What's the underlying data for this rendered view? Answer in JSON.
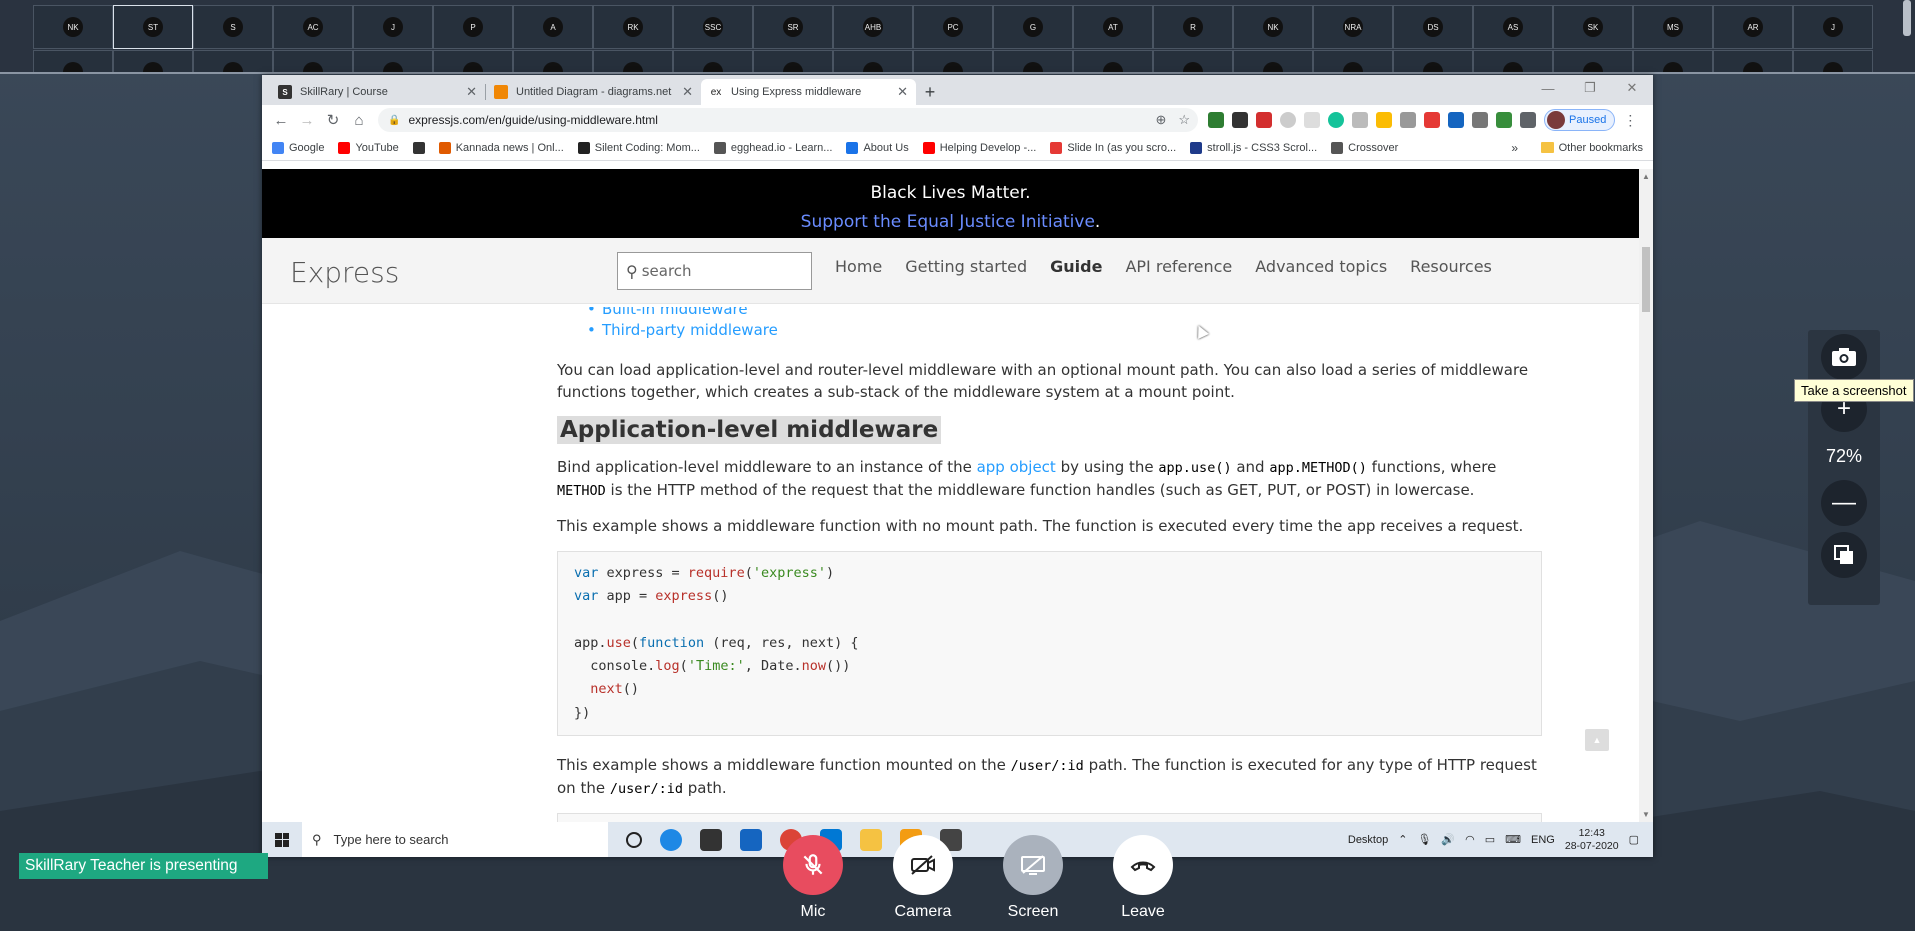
{
  "participants": {
    "row1": [
      "NK",
      "ST",
      "S",
      "AC",
      "J",
      "P",
      "A",
      "RK",
      "SSC",
      "SR",
      "AHB",
      "PC",
      "G",
      "AT",
      "R",
      "NK",
      "NRA",
      "DS",
      "AS",
      "SK",
      "MS",
      "AR",
      "J"
    ],
    "row2": [
      "",
      "",
      "",
      "",
      "",
      "",
      "",
      "",
      "",
      "",
      "",
      "",
      "",
      "",
      "",
      "",
      "",
      "",
      "",
      "",
      "",
      "",
      ""
    ],
    "active_index": 1
  },
  "browser": {
    "tabs": [
      {
        "title": "SkillRary | Course",
        "icon_text": "S",
        "icon_color": "#333333"
      },
      {
        "title": "Untitled Diagram - diagrams.net",
        "icon_text": "",
        "icon_color": "#f08705"
      },
      {
        "title": "Using Express middleware",
        "icon_text": "ex",
        "icon_color": "#ffffff"
      }
    ],
    "new_tab": "+",
    "url": "expressjs.com/en/guide/using-middleware.html",
    "profile_status": "Paused",
    "bookmarks": [
      {
        "label": "Google",
        "color": "#4285f4"
      },
      {
        "label": "YouTube",
        "color": "#ff0000"
      },
      {
        "label": "",
        "color": "#333333"
      },
      {
        "label": "Kannada news | Onl...",
        "color": "#e05a00"
      },
      {
        "label": "Silent Coding: Mom...",
        "color": "#222222"
      },
      {
        "label": "egghead.io - Learn...",
        "color": "#555555"
      },
      {
        "label": "About Us",
        "color": "#1a73e8"
      },
      {
        "label": "Helping Develop -...",
        "color": "#ff0000"
      },
      {
        "label": "Slide In (as you scro...",
        "color": "#e53935"
      },
      {
        "label": "stroll.js - CSS3 Scrol...",
        "color": "#1e3a8a"
      },
      {
        "label": "Crossover",
        "color": "#555555"
      }
    ],
    "bookmarks_more": "»",
    "other_bookmarks": "Other bookmarks"
  },
  "page": {
    "banner_line1": "Black Lives Matter.",
    "banner_link": "Support the Equal Justice Initiative",
    "banner_period": ".",
    "logo": "Express",
    "search_placeholder": "search",
    "nav": [
      "Home",
      "Getting started",
      "Guide",
      "API reference",
      "Advanced topics",
      "Resources"
    ],
    "toc_cut": "Built-in middleware",
    "toc_item": "Third-party middleware",
    "para1": "You can load application-level and router-level middleware with an optional mount path. You can also load a series of middleware functions together, which creates a sub-stack of the middleware system at a mount point.",
    "heading": "Application-level middleware",
    "para2_a": "Bind application-level middleware to an instance of the ",
    "para2_link": "app object",
    "para2_b": " by using the ",
    "para2_code1": "app.use()",
    "para2_c": " and ",
    "para2_code2": "app.METHOD()",
    "para2_d": " functions, where ",
    "para2_code3": "METHOD",
    "para2_e": " is the HTTP method of the request that the middleware function handles (such as GET, PUT, or POST) in lowercase.",
    "para3": "This example shows a middleware function with no mount path. The function is executed every time the app receives a request.",
    "para4_a": "This example shows a middleware function mounted on the ",
    "para4_code1": "/user/:id",
    "para4_b": " path. The function is executed for any type of HTTP request on the ",
    "para4_code2": "/user/:id",
    "para4_c": " path."
  },
  "taskbar": {
    "search_placeholder": "Type here to search",
    "desktop_label": "Desktop",
    "lang": "ENG",
    "time": "12:43",
    "date": "28-07-2020"
  },
  "meeting": {
    "presenting": "SkillRary Teacher is presenting",
    "mic": "Mic",
    "camera": "Camera",
    "screen": "Screen",
    "leave": "Leave",
    "zoom": "72%",
    "tooltip": "Take a screenshot"
  }
}
